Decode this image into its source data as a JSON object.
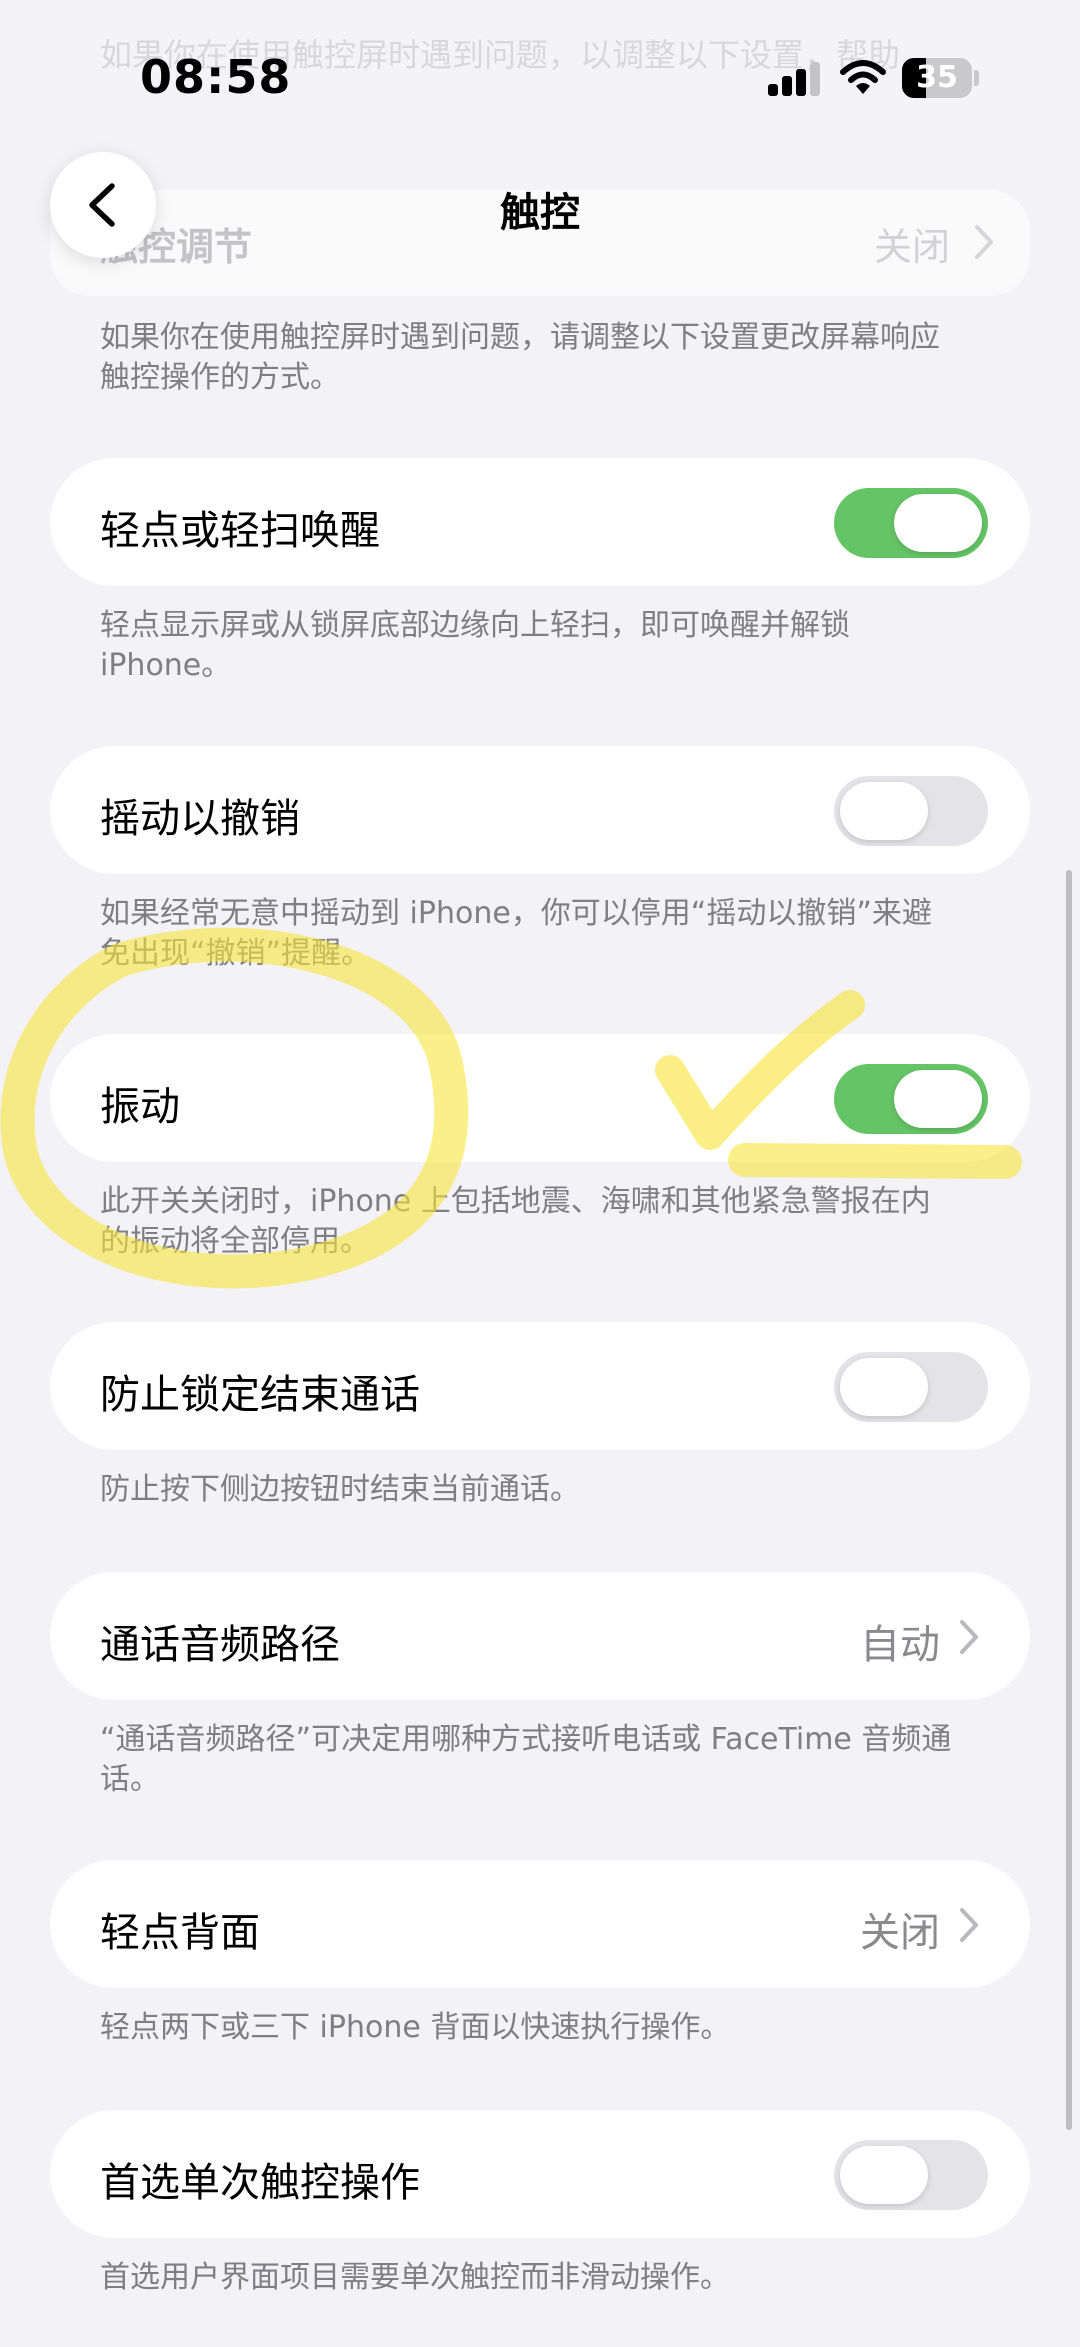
{
  "status_bar": {
    "time": "08:58",
    "battery": "35"
  },
  "background": {
    "ghost_text": "如果你在使用触控屏时遇到问题，以调整以下设置，帮助",
    "ghost_row_label": "触控调节",
    "ghost_row_value": "关闭"
  },
  "nav": {
    "title": "触控"
  },
  "intro": "如果你在使用触控屏时遇到问题，请调整以下设置更改屏幕响应触控操作的方式。",
  "settings": [
    {
      "label": "轻点或轻扫唤醒",
      "toggle": true,
      "footer": "轻点显示屏或从锁屏底部边缘向上轻扫，即可唤醒并解锁 iPhone。"
    },
    {
      "label": "摇动以撤销",
      "toggle": false,
      "footer": "如果经常无意中摇动到 iPhone，你可以停用“摇动以撤销”来避免出现“撤销”提醒。"
    },
    {
      "label": "振动",
      "toggle": true,
      "footer": "此开关关闭时，iPhone 上包括地震、海啸和其他紧急警报在内的振动将全部停用。"
    },
    {
      "label": "防止锁定结束通话",
      "toggle": false,
      "footer": "防止按下侧边按钮时结束当前通话。"
    },
    {
      "label": "通话音频路径",
      "value": "自动",
      "footer": "“通话音频路径”可决定用哪种方式接听电话或 FaceTime 音频通话。"
    },
    {
      "label": "轻点背面",
      "value": "关闭",
      "footer": "轻点两下或三下 iPhone 背面以快速执行操作。"
    },
    {
      "label": "首选单次触控操作",
      "toggle": false,
      "footer": "首选用户界面项目需要单次触控而非滑动操作。"
    }
  ],
  "colors": {
    "toggle_on": "#65C466",
    "toggle_off": "#E4E4E8",
    "annotation": "#F7E43A"
  }
}
